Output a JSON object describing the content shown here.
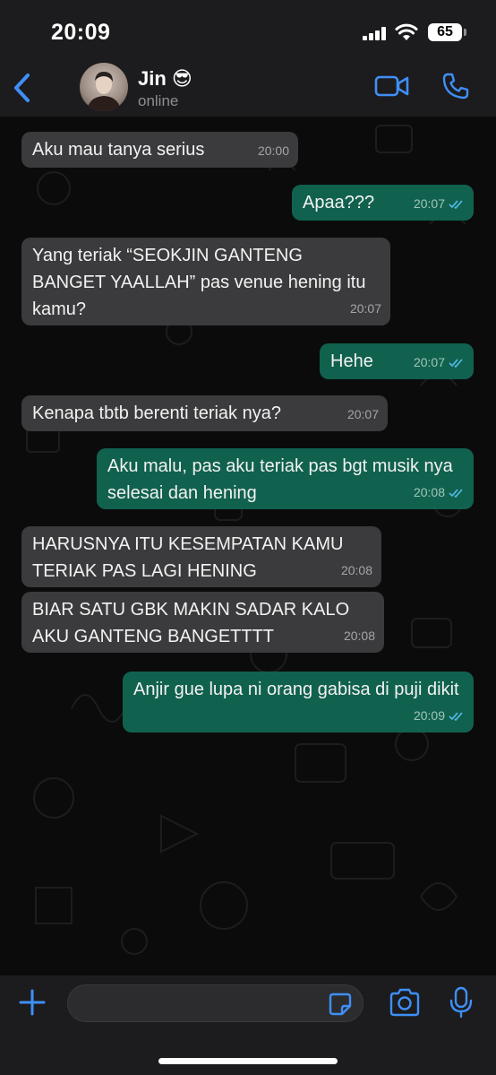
{
  "status_bar": {
    "time": "20:09",
    "battery": "65"
  },
  "contact": {
    "name": "Jin 😎",
    "status": "online"
  },
  "colors": {
    "accent": "#3f8ff7",
    "incoming_bubble": "#3b3b3d",
    "outgoing_bubble": "#11614f",
    "read_ticks": "#53bdeb"
  },
  "icons": [
    "back-icon",
    "video-call-icon",
    "phone-icon",
    "plus-icon",
    "sticker-icon",
    "camera-icon",
    "microphone-icon",
    "read-ticks-icon"
  ],
  "messages": [
    {
      "direction": "in",
      "text": "Aku mau tanya serius",
      "time": "20:00"
    },
    {
      "direction": "out",
      "text": "Apaa???",
      "time": "20:07",
      "status": "read"
    },
    {
      "direction": "in",
      "text": "Yang teriak “SEOKJIN GANTENG BANGET YAALLAH” pas venue hening itu kamu?",
      "time": "20:07"
    },
    {
      "direction": "out",
      "text": "Hehe",
      "time": "20:07",
      "status": "read"
    },
    {
      "direction": "in",
      "text": "Kenapa tbtb berenti teriak nya?",
      "time": "20:07"
    },
    {
      "direction": "out",
      "text": "Aku malu, pas aku teriak pas bgt musik nya selesai dan hening",
      "time": "20:08",
      "status": "read"
    },
    {
      "direction": "in",
      "text": "HARUSNYA ITU KESEMPATAN KAMU TERIAK PAS LAGI HENING",
      "time": "20:08"
    },
    {
      "direction": "in",
      "text": "BIAR SATU GBK MAKIN SADAR KALO AKU GANTENG BANGETTTT",
      "time": "20:08"
    },
    {
      "direction": "out",
      "text": "Anjir gue lupa ni orang gabisa di puji dikit",
      "time": "20:09",
      "status": "read"
    }
  ],
  "input": {
    "value": "",
    "placeholder": ""
  }
}
